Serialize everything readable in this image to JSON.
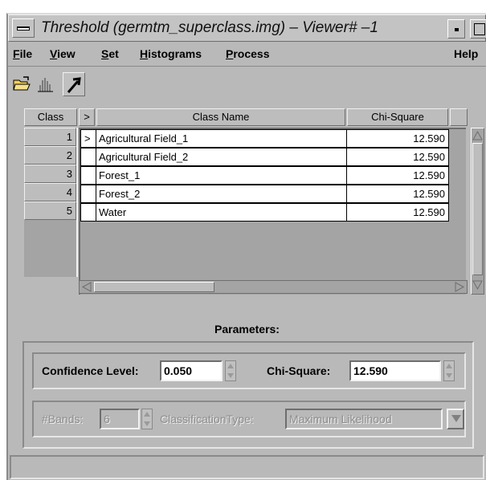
{
  "window": {
    "title": "Threshold (germtm_superclass.img) – Viewer# –1"
  },
  "menubar": {
    "items": [
      {
        "label": "File",
        "mnemonic": "F",
        "rest": "ile"
      },
      {
        "label": "View",
        "mnemonic": "V",
        "rest": "iew"
      },
      {
        "label": "Set",
        "mnemonic": "S",
        "rest": "et"
      },
      {
        "label": "Histograms",
        "mnemonic": "H",
        "rest": "istograms"
      },
      {
        "label": "Process",
        "mnemonic": "P",
        "rest": "rocess"
      }
    ],
    "help": "Help"
  },
  "toolbar": {
    "icons": [
      "open-folder-icon",
      "histogram-icon",
      "arrow-pointer-icon"
    ]
  },
  "table": {
    "headers": {
      "class": "Class",
      "marker": ">",
      "class_name": "Class Name",
      "chi_square": "Chi-Square"
    },
    "rows": [
      {
        "num": "1",
        "marker": ">",
        "name": "Agricultural Field_1",
        "chi": "12.590"
      },
      {
        "num": "2",
        "marker": "",
        "name": "Agricultural Field_2",
        "chi": "12.590"
      },
      {
        "num": "3",
        "marker": "",
        "name": "Forest_1",
        "chi": "12.590"
      },
      {
        "num": "4",
        "marker": "",
        "name": "Forest_2",
        "chi": "12.590"
      },
      {
        "num": "5",
        "marker": "",
        "name": "Water",
        "chi": "12.590"
      }
    ]
  },
  "parameters": {
    "title": "Parameters:",
    "confidence_label": "Confidence Level:",
    "confidence_value": "0.050",
    "chi_label": "Chi-Square:",
    "chi_value": "12.590",
    "bands_label": "#Bands:",
    "bands_value": "6",
    "classification_label": "ClassificationType:",
    "classification_value": "Maximum Likelihood"
  },
  "status": {
    "text": ""
  }
}
